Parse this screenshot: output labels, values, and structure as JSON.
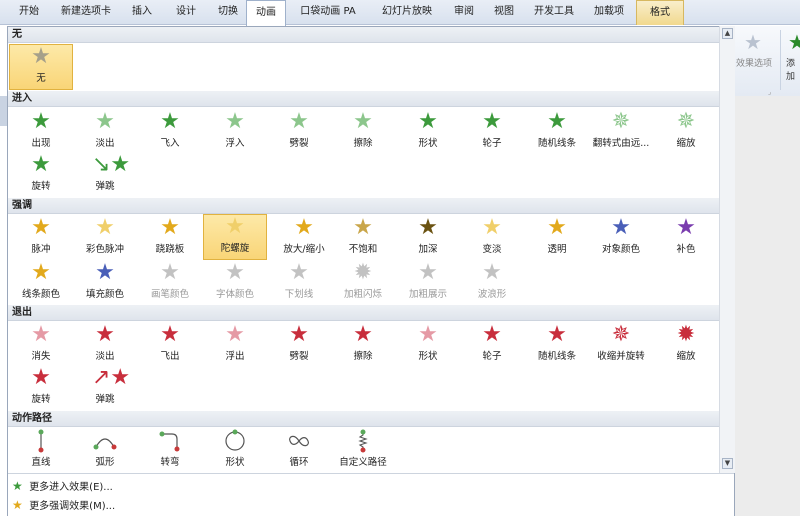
{
  "tabs": [
    "开始",
    "新建选项卡",
    "插入",
    "设计",
    "切换",
    "动画",
    "口袋动画 PA",
    "幻灯片放映",
    "审阅",
    "视图",
    "开发工具",
    "加载项",
    "格式"
  ],
  "ribbon": {
    "effect_options": "效果选项",
    "add": "添加"
  },
  "sections": {
    "none": {
      "title": "无",
      "items": [
        "无"
      ]
    },
    "entrance": {
      "title": "进入",
      "items": [
        "出现",
        "淡出",
        "飞入",
        "浮入",
        "劈裂",
        "擦除",
        "形状",
        "轮子",
        "随机线条",
        "翻转式由远...",
        "缩放",
        "旋转",
        "弹跳"
      ]
    },
    "emphasis": {
      "title": "强调",
      "items": [
        "脉冲",
        "彩色脉冲",
        "跷跷板",
        "陀螺旋",
        "放大/缩小",
        "不饱和",
        "加深",
        "变淡",
        "透明",
        "对象颜色",
        "补色",
        "线条颜色",
        "填充颜色",
        "画笔颜色",
        "字体颜色",
        "下划线",
        "加粗闪烁",
        "加粗展示",
        "波浪形"
      ]
    },
    "exit": {
      "title": "退出",
      "items": [
        "消失",
        "淡出",
        "飞出",
        "浮出",
        "劈裂",
        "擦除",
        "形状",
        "轮子",
        "随机线条",
        "收缩并旋转",
        "缩放",
        "旋转",
        "弹跳"
      ]
    },
    "motion": {
      "title": "动作路径",
      "items": [
        "直线",
        "弧形",
        "转弯",
        "形状",
        "循环",
        "自定义路径"
      ]
    }
  },
  "footer": {
    "more_entrance": "更多进入效果(E)...",
    "more_emphasis": "更多强调效果(M)..."
  },
  "selected_item": "陀螺旋"
}
